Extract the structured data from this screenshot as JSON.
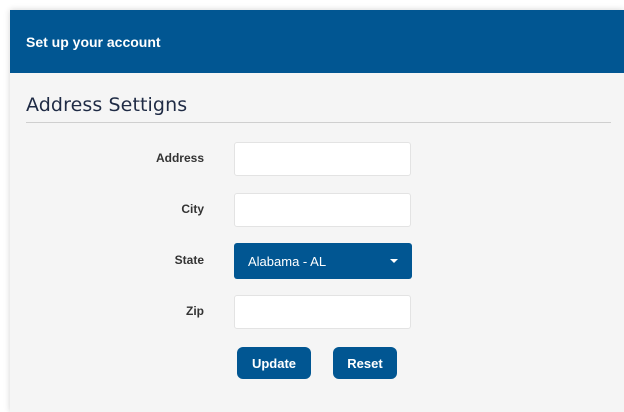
{
  "header": {
    "title": "Set up your account"
  },
  "section": {
    "title": "Address Settigns"
  },
  "form": {
    "address_label": "Address",
    "address_value": "",
    "city_label": "City",
    "city_value": "",
    "state_label": "State",
    "state_value": "Alabama - AL",
    "zip_label": "Zip",
    "zip_value": ""
  },
  "buttons": {
    "update": "Update",
    "reset": "Reset"
  },
  "colors": {
    "primary": "#015692",
    "panel": "#f5f5f5",
    "heading": "#1f2b45"
  }
}
